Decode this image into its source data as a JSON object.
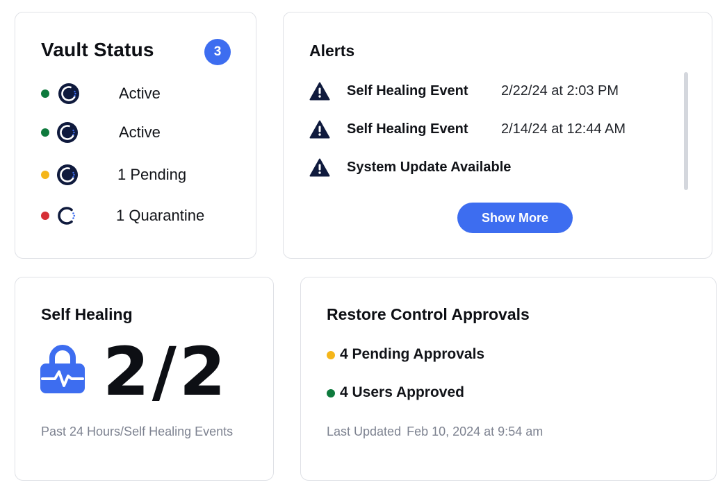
{
  "colors": {
    "accent": "#3d6df0",
    "active": "#0e7a3d",
    "pending": "#f5b61a",
    "quarantine": "#d62f36",
    "icon_dark": "#0f1a3d"
  },
  "vault_status": {
    "title": "Vault Status",
    "badge": "3",
    "rows": [
      {
        "label": "Active",
        "status": "active",
        "icon": "vault-icon"
      },
      {
        "label": "Active",
        "status": "active",
        "icon": "vault-icon"
      },
      {
        "label": "1 Pending",
        "status": "pending",
        "icon": "vault-icon"
      },
      {
        "label": "1 Quarantine",
        "status": "quarantine",
        "icon": "vault-quarantine-icon"
      }
    ]
  },
  "alerts": {
    "title": "Alerts",
    "items": [
      {
        "name": "Self Healing Event",
        "time": "2/22/24 at 2:03 PM",
        "icon": "warning-icon"
      },
      {
        "name": "Self Healing Event",
        "time": "2/14/24 at 12:44 AM",
        "icon": "warning-icon"
      },
      {
        "name": "System Update Available",
        "time": "",
        "icon": "warning-icon"
      }
    ],
    "show_more_label": "Show More"
  },
  "self_healing": {
    "title": "Self Healing",
    "count": "2/2",
    "icon": "lock-heartbeat-icon",
    "subtitle": "Past 24 Hours/Self Healing Events"
  },
  "restore_control": {
    "title": "Restore Control Approvals",
    "items": [
      {
        "label": "4 Pending Approvals",
        "status": "pending"
      },
      {
        "label": "4 Users Approved",
        "status": "active"
      }
    ],
    "updated_label": "Last Updated",
    "updated_value": "Feb 10, 2024 at 9:54 am"
  }
}
